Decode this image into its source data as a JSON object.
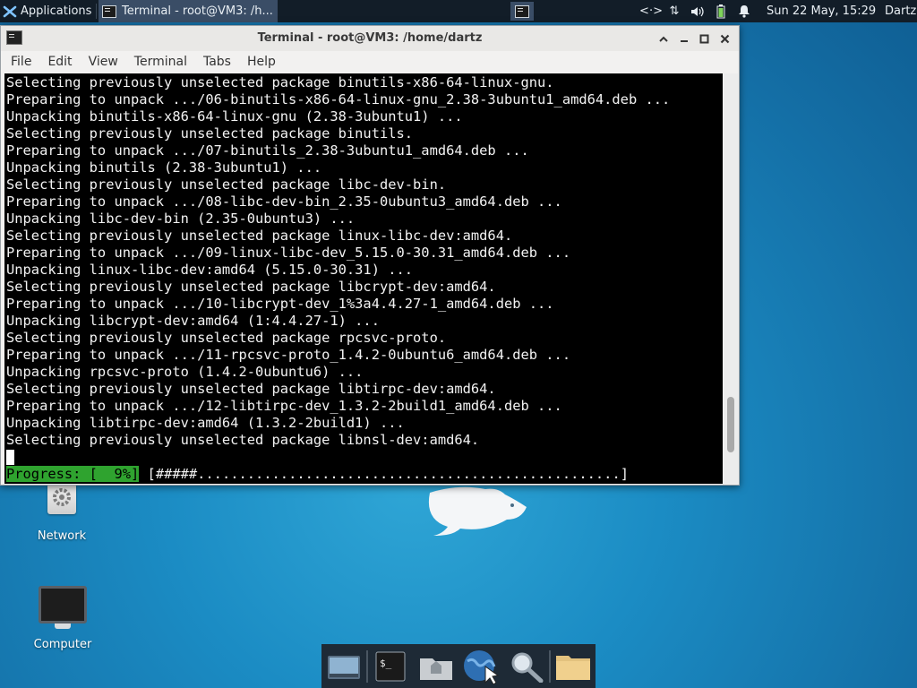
{
  "panel": {
    "applications_label": "Applications",
    "task_title": "Terminal - root@VM3: /h...",
    "clock": "Sun 22 May, 15:29",
    "user": "Dartz"
  },
  "desktop": {
    "icons": [
      {
        "label": "Network"
      },
      {
        "label": "Computer"
      }
    ]
  },
  "window": {
    "title": "Terminal - root@VM3: /home/dartz",
    "menu": [
      "File",
      "Edit",
      "View",
      "Terminal",
      "Tabs",
      "Help"
    ],
    "lines": [
      "Selecting previously unselected package binutils-x86-64-linux-gnu.",
      "Preparing to unpack .../06-binutils-x86-64-linux-gnu_2.38-3ubuntu1_amd64.deb ...",
      "Unpacking binutils-x86-64-linux-gnu (2.38-3ubuntu1) ...",
      "Selecting previously unselected package binutils.",
      "Preparing to unpack .../07-binutils_2.38-3ubuntu1_amd64.deb ...",
      "Unpacking binutils (2.38-3ubuntu1) ...",
      "Selecting previously unselected package libc-dev-bin.",
      "Preparing to unpack .../08-libc-dev-bin_2.35-0ubuntu3_amd64.deb ...",
      "Unpacking libc-dev-bin (2.35-0ubuntu3) ...",
      "Selecting previously unselected package linux-libc-dev:amd64.",
      "Preparing to unpack .../09-linux-libc-dev_5.15.0-30.31_amd64.deb ...",
      "Unpacking linux-libc-dev:amd64 (5.15.0-30.31) ...",
      "Selecting previously unselected package libcrypt-dev:amd64.",
      "Preparing to unpack .../10-libcrypt-dev_1%3a4.4.27-1_amd64.deb ...",
      "Unpacking libcrypt-dev:amd64 (1:4.4.27-1) ...",
      "Selecting previously unselected package rpcsvc-proto.",
      "Preparing to unpack .../11-rpcsvc-proto_1.4.2-0ubuntu6_amd64.deb ...",
      "Unpacking rpcsvc-proto (1.4.2-0ubuntu6) ...",
      "Selecting previously unselected package libtirpc-dev:amd64.",
      "Preparing to unpack .../12-libtirpc-dev_1.3.2-2build1_amd64.deb ...",
      "Unpacking libtirpc-dev:amd64 (1.3.2-2build1) ...",
      "Selecting previously unselected package libnsl-dev:amd64."
    ],
    "progress_label": "Progress: [  9%]",
    "progress_bar": "[#####...................................................]",
    "scroll_position": 0.92
  },
  "dock": {
    "icons": [
      "show-desktop-icon",
      "terminal-icon",
      "home-folder-icon",
      "web-browser-icon",
      "search-icon",
      "files-icon"
    ]
  },
  "colors": {
    "panel_bg": "#121d28",
    "active_task": "#3a4d66",
    "progress_green": "#2fa32f",
    "terminal_bg": "#000000"
  }
}
